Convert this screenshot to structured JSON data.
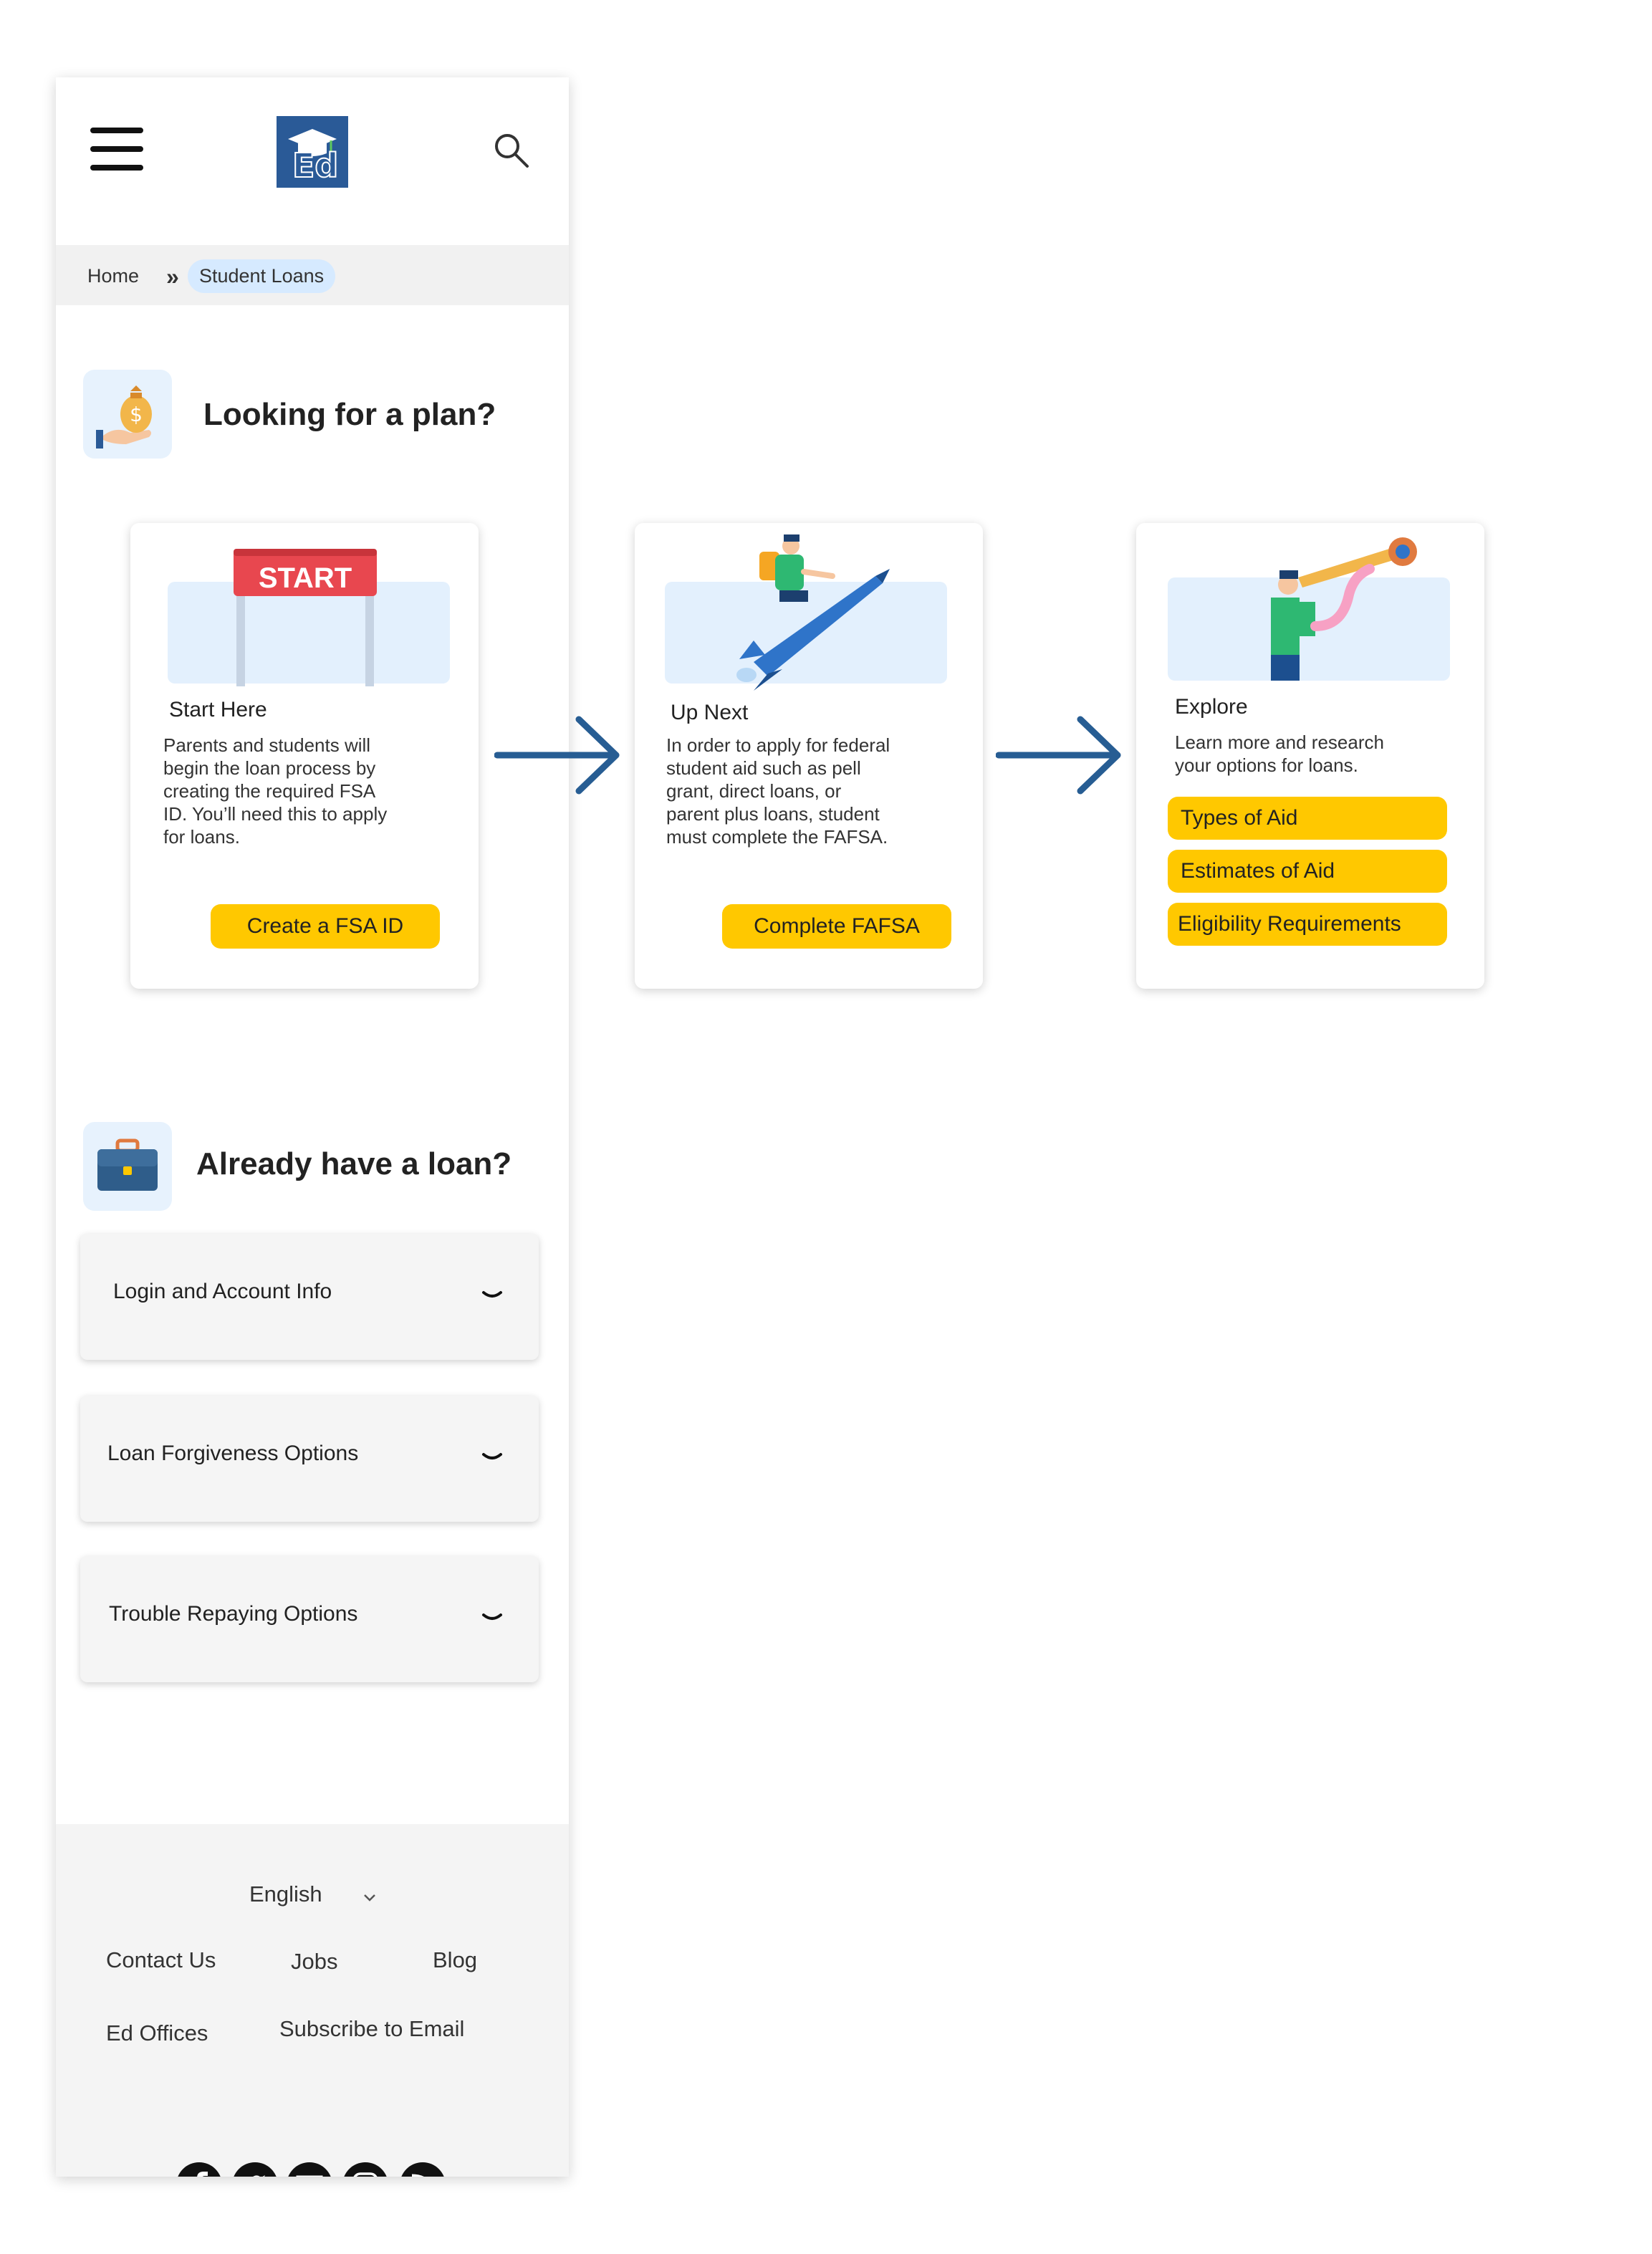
{
  "header": {
    "menu_icon": "hamburger-icon",
    "logo_text": "Ed",
    "search_icon": "search-icon"
  },
  "breadcrumb": {
    "home": "Home",
    "separator": "»",
    "current": "Student Loans"
  },
  "plan_section": {
    "title": "Looking for a plan?",
    "icon": "money-bag-icon",
    "cards": [
      {
        "illustration_text": "START",
        "title": "Start Here",
        "desc_lines": [
          "Parents and students will",
          "begin the loan process by",
          "creating the required FSA",
          "ID. You’ll need this to apply",
          "for loans."
        ],
        "button": "Create a FSA ID"
      },
      {
        "title": "Up Next",
        "desc_lines": [
          "In order to apply for federal",
          "student aid such as pell",
          "grant, direct loans, or",
          "parent plus loans, student",
          "must complete the FAFSA."
        ],
        "button": "Complete FAFSA"
      },
      {
        "title": "Explore",
        "desc_lines": [
          "Learn more and research",
          "your options for loans."
        ],
        "buttons": [
          "Types of Aid",
          "Estimates of Aid",
          "Eligibility Requirements"
        ]
      }
    ]
  },
  "loan_section": {
    "title": "Already have a loan?",
    "icon": "briefcase-icon",
    "accordions": [
      "Login and Account Info",
      "Loan Forgiveness Options",
      "Trouble Repaying Options"
    ]
  },
  "footer": {
    "language": "English",
    "links": [
      "Contact Us",
      "Jobs",
      "Blog",
      "Ed Offices",
      "Subscribe to Email"
    ],
    "social_icons": [
      "facebook-icon",
      "twitter-icon",
      "email-icon",
      "instagram-icon",
      "rss-icon"
    ]
  },
  "colors": {
    "accent_yellow": "#ffc800",
    "arrow_blue": "#275d93",
    "logo_blue": "#2a5a97",
    "light_blue": "#e3f0fd"
  }
}
